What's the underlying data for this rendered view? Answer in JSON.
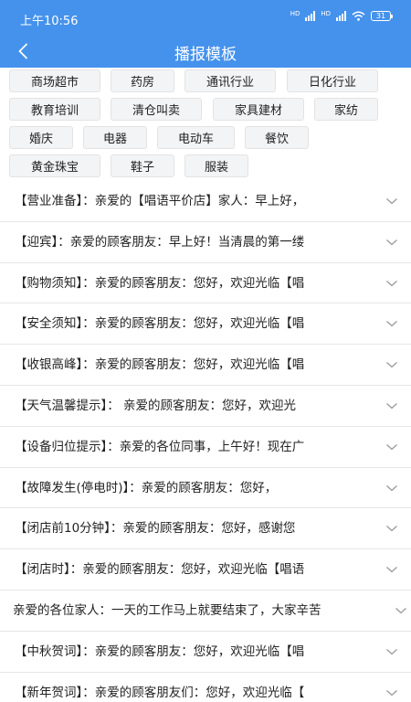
{
  "status": {
    "time": "上午10:56",
    "hd1": "HD",
    "hd2": "HD",
    "battery": "31"
  },
  "header": {
    "title": "播报模板"
  },
  "colors": {
    "header_bg": "#4592ec",
    "chip_bg": "#f3f4f6",
    "divider": "#e6e6e6"
  },
  "icons": {
    "back": "chevron-left-icon",
    "expand": "chevron-down-icon",
    "wifi": "wifi-icon",
    "signal": "signal-icon",
    "battery": "battery-icon"
  },
  "categories": [
    "商场超市",
    "药房",
    "通讯行业",
    "日化行业",
    "教育培训",
    "清仓叫卖",
    "家具建材",
    "家纺",
    "婚庆",
    "电器",
    "电动车",
    "餐饮",
    "黄金珠宝",
    "鞋子",
    "服装"
  ],
  "templates": [
    "【营业准备】：亲爱的【唱语平价店】家人：早上好，",
    "【迎宾】：亲爱的顾客朋友：早上好！当清晨的第一缕",
    "【购物须知】：亲爱的顾客朋友：您好，欢迎光临【唱",
    "【安全须知】：亲爱的顾客朋友：您好，欢迎光临【唱",
    "【收银高峰】：亲爱的顾客朋友：您好，欢迎光临【唱",
    "【天气温馨提示】：  亲爱的顾客朋友：您好，欢迎光",
    "【设备归位提示】：亲爱的各位同事，上午好！现在广",
    "【故障发生(停电时)】：亲爱的顾客朋友：您好，",
    "【闭店前10分钟】：亲爱的顾客朋友：您好，感谢您",
    "【闭店时】：亲爱的顾客朋友：您好，欢迎光临【唱语",
    "亲爱的各位家人：一天的工作马上就要结束了，大家辛苦",
    "【中秋贺词】：亲爱的顾客朋友：您好，欢迎光临【唱",
    "【新年贺词】：亲爱的顾客朋友们：您好，欢迎光临【"
  ]
}
